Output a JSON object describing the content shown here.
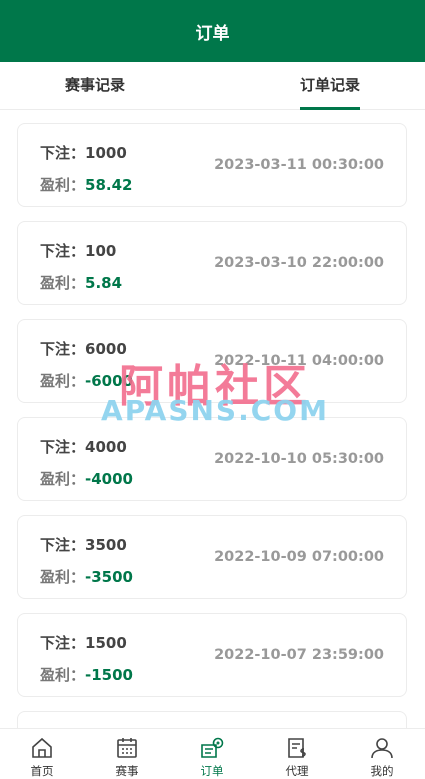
{
  "header": {
    "title": "订单"
  },
  "tabs": [
    {
      "label": "赛事记录"
    },
    {
      "label": "订单记录"
    }
  ],
  "orders": [
    {
      "bet_label": "下注：",
      "bet": "1000",
      "profit_label": "盈利：",
      "profit": "58.42",
      "time": "2023-03-11 00:30:00"
    },
    {
      "bet_label": "下注：",
      "bet": "100",
      "profit_label": "盈利：",
      "profit": "5.84",
      "time": "2023-03-10 22:00:00"
    },
    {
      "bet_label": "下注：",
      "bet": "6000",
      "profit_label": "盈利：",
      "profit": "-6000",
      "time": "2022-10-11 04:00:00"
    },
    {
      "bet_label": "下注：",
      "bet": "4000",
      "profit_label": "盈利：",
      "profit": "-4000",
      "time": "2022-10-10 05:30:00"
    },
    {
      "bet_label": "下注：",
      "bet": "3500",
      "profit_label": "盈利：",
      "profit": "-3500",
      "time": "2022-10-09 07:00:00"
    },
    {
      "bet_label": "下注：",
      "bet": "1500",
      "profit_label": "盈利：",
      "profit": "-1500",
      "time": "2022-10-07 23:59:00"
    }
  ],
  "watermark": {
    "cn": "阿帕社区",
    "en": "APASNS.COM"
  },
  "nav": [
    {
      "label": "首页",
      "icon": "home-icon"
    },
    {
      "label": "赛事",
      "icon": "calendar-icon"
    },
    {
      "label": "订单",
      "icon": "order-icon"
    },
    {
      "label": "代理",
      "icon": "agent-icon"
    },
    {
      "label": "我的",
      "icon": "user-icon"
    }
  ],
  "colors": {
    "brand": "#00774a",
    "watermark_cn": "#f26d8d",
    "watermark_en": "#8fd3ef"
  }
}
